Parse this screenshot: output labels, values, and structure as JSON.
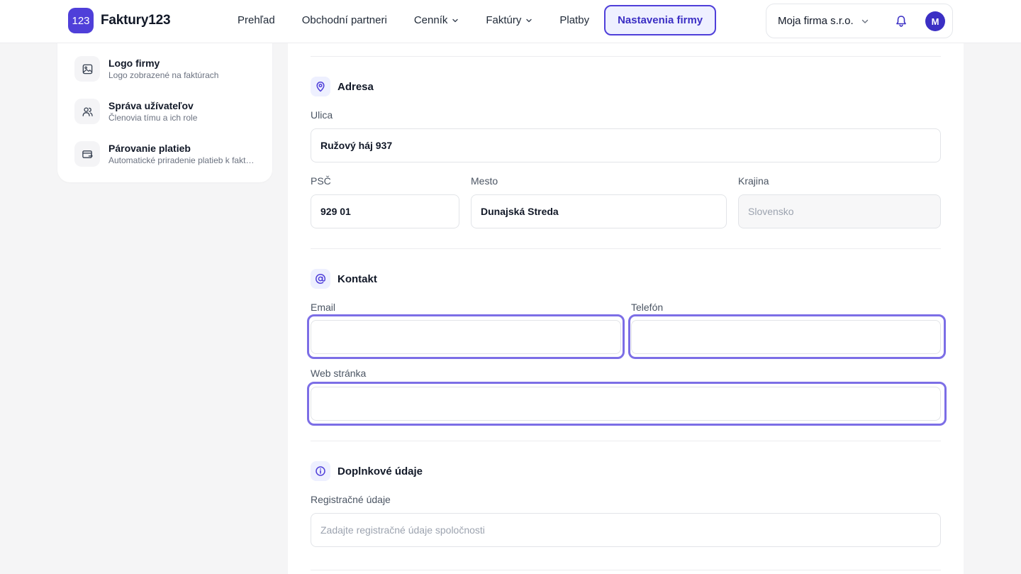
{
  "brand": {
    "badge": "123",
    "name": "Faktury123"
  },
  "nav": {
    "items": [
      {
        "label": "Prehľad",
        "has_chevron": false
      },
      {
        "label": "Obchodní partneri",
        "has_chevron": false
      },
      {
        "label": "Cenník",
        "has_chevron": true
      },
      {
        "label": "Faktúry",
        "has_chevron": true
      },
      {
        "label": "Platby",
        "has_chevron": false
      },
      {
        "label": "Nastavenia firmy",
        "has_chevron": false,
        "active": true
      }
    ]
  },
  "account": {
    "company": "Moja firma s.r.o.",
    "avatar_initial": "M"
  },
  "sidebar": {
    "items": [
      {
        "title": "Logo firmy",
        "subtitle": "Logo zobrazené na faktúrach",
        "icon": "image-icon"
      },
      {
        "title": "Správa užívateľov",
        "subtitle": "Členovia tímu a ich role",
        "icon": "users-icon"
      },
      {
        "title": "Párovanie platieb",
        "subtitle": "Automatické priradenie platieb k faktúram",
        "icon": "payment-match-icon"
      }
    ]
  },
  "address": {
    "title": "Adresa",
    "street_label": "Ulica",
    "street_value": "Ružový háj 937",
    "zip_label": "PSČ",
    "zip_value": "929 01",
    "city_label": "Mesto",
    "city_value": "Dunajská Streda",
    "country_label": "Krajina",
    "country_value": "Slovensko"
  },
  "contact": {
    "title": "Kontakt",
    "email_label": "Email",
    "email_value": "",
    "phone_label": "Telefón",
    "phone_value": "",
    "web_label": "Web stránka",
    "web_value": ""
  },
  "extra": {
    "title": "Doplnkové údaje",
    "registration_label": "Registračné údaje",
    "registration_placeholder": "Zadajte registračné údaje spoločnosti"
  },
  "colors": {
    "accent": "#4f3fd9",
    "focus": "#7c6ee6",
    "background": "#f5f5f6"
  }
}
